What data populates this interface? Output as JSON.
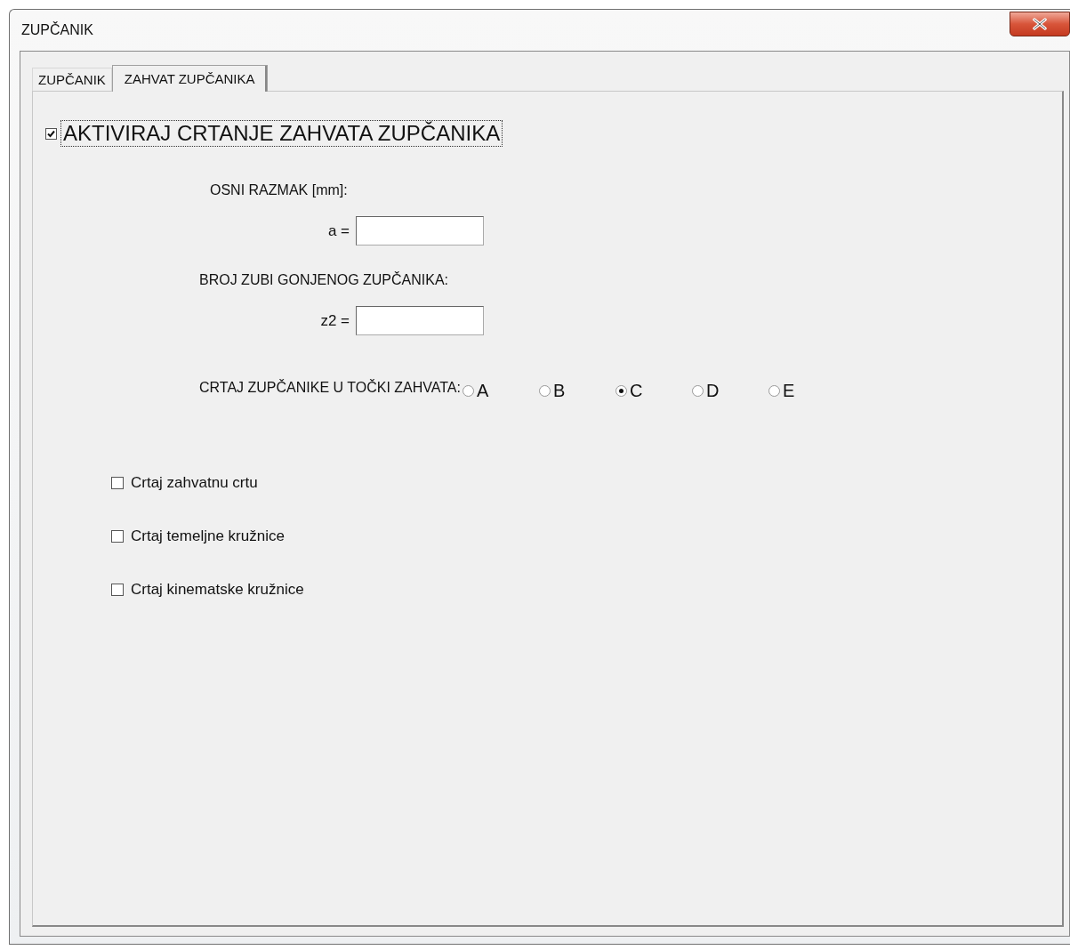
{
  "window": {
    "title": "ZUPČANIK"
  },
  "tabs": [
    {
      "label": "ZUPČANIK",
      "selected": false
    },
    {
      "label": "ZAHVAT ZUPČANIKA",
      "selected": true
    }
  ],
  "enable": {
    "label": "AKTIVIRAJ CRTANJE ZAHVATA ZUPČANIKA",
    "checked": true
  },
  "fields": [
    {
      "heading": "OSNI RAZMAK [mm]:",
      "label": "a ="
    },
    {
      "heading": "BROJ ZUBI GONJENOG ZUPČANIKA:",
      "label": "z2 ="
    }
  ],
  "point": {
    "label": "CRTAJ ZUPČANIKE U TOČKI ZAHVATA:",
    "options": [
      {
        "label": "A",
        "selected": false
      },
      {
        "label": "B",
        "selected": false
      },
      {
        "label": "C",
        "selected": true
      },
      {
        "label": "D",
        "selected": false
      },
      {
        "label": "E",
        "selected": false
      }
    ]
  },
  "options": [
    {
      "label": "Crtaj zahvatnu crtu",
      "checked": false
    },
    {
      "label": "Crtaj temeljne kružnice",
      "checked": false
    },
    {
      "label": "Crtaj kinematske kružnice",
      "checked": false
    }
  ]
}
